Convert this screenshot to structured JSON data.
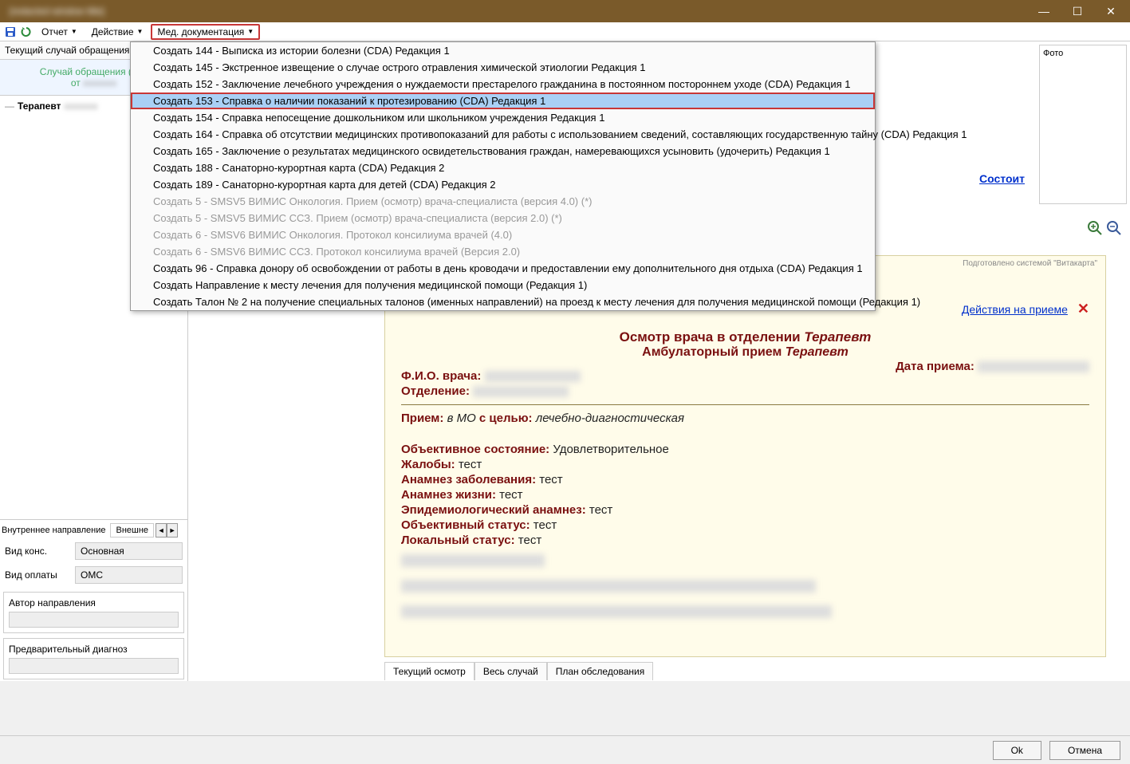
{
  "titlebar": {
    "text": "[redacted window title]"
  },
  "toolbar": {
    "report": "Отчет",
    "action": "Действие",
    "med_doc": "Мед. документация"
  },
  "left": {
    "current_case": "Текущий случай обращения",
    "case_line1": "Случай обращения (<не",
    "case_line2": "от",
    "tree_specialist": "Терапевт",
    "tab_internal": "Внутреннее направление",
    "tab_external": "Внешне",
    "cons_label": "Вид конс.",
    "cons_value": "Основная",
    "pay_label": "Вид оплаты",
    "pay_value": "ОМС",
    "author_label": "Автор направления",
    "diag_label": "Предварительный диагноз"
  },
  "right": {
    "photo": "Фото",
    "status": "Состоит",
    "watermark": "Подготовлено системой \"Витакарта\"",
    "actions_link": "Действия на приеме",
    "doc_title_1": "Осмотр врача в отделении ",
    "doc_title_1_ital": "Терапевт",
    "doc_title_2": "Амбулаторный прием ",
    "doc_title_2_ital": "Терапевт",
    "doctor_label": "Ф.И.О. врача:",
    "dept_label": "Отделение:",
    "date_label": "Дата приема:",
    "visit_label": "Прием:",
    "visit_where": "в МО",
    "visit_goal_label": "с целью:",
    "visit_goal": "лечебно-диагностическая",
    "obj_state_label": "Объективное состояние:",
    "obj_state_val": "Удовлетворительное",
    "complaints_label": "Жалобы:",
    "test": "тест",
    "anamnez_dis_label": "Анамнез заболевания:",
    "anamnez_life_label": "Анамнез жизни:",
    "epid_label": "Эпидемиологический анамнез:",
    "obj_status_label": "Объективный статус:",
    "local_status_label": "Локальный статус:"
  },
  "bottom_tabs": {
    "current": "Текущий осмотр",
    "full": "Весь случай",
    "plan": "План обследования"
  },
  "footer": {
    "ok": "Ok",
    "cancel": "Отмена"
  },
  "dropdown": [
    {
      "text": "Создать 144 -  Выписка из истории болезни (CDA) Редакция 1",
      "disabled": false,
      "selected": false
    },
    {
      "text": "Создать 145 - Экстренное извещение о случае острого отравления химической этиологии Редакция 1",
      "disabled": false,
      "selected": false
    },
    {
      "text": "Создать 152 - Заключение лечебного учреждения о нуждаемости престарелого гражданина в постоянном постороннем уходе (CDA) Редакция 1",
      "disabled": false,
      "selected": false
    },
    {
      "text": "Создать 153 - Справка о наличии показаний к протезированию (CDA) Редакция 1",
      "disabled": false,
      "selected": true
    },
    {
      "text": "Создать 154 - Справка непосещение дошкольником или школьником учреждения Редакция 1",
      "disabled": false,
      "selected": false
    },
    {
      "text": "Создать 164 - Справка об отсутствии медицинских противопоказаний для работы с использованием сведений, составляющих государственную тайну (CDA) Редакция 1",
      "disabled": false,
      "selected": false
    },
    {
      "text": "Создать 165 - Заключение о результатах медицинского освидетельствования граждан, намеревающихся усыновить (удочерить) Редакция 1",
      "disabled": false,
      "selected": false
    },
    {
      "text": "Создать 188 - Санаторно-курортная карта (CDA) Редакция 2",
      "disabled": false,
      "selected": false
    },
    {
      "text": "Создать 189 - Санаторно-курортная карта для детей (CDA) Редакция 2",
      "disabled": false,
      "selected": false
    },
    {
      "text": "Создать 5 - SMSV5 ВИМИС Онкология. Прием (осмотр) врача-специалиста  (версия 4.0) (*)",
      "disabled": true,
      "selected": false
    },
    {
      "text": "Создать 5 - SMSV5 ВИМИС ССЗ. Прием (осмотр) врача-специалиста (версия 2.0) (*)",
      "disabled": true,
      "selected": false
    },
    {
      "text": "Создать 6 - SMSV6 ВИМИС Онкология. Протокол консилиума врачей (4.0)",
      "disabled": true,
      "selected": false
    },
    {
      "text": "Создать 6 - SMSV6 ВИМИС ССЗ. Протокол консилиума врачей (Версия 2.0)",
      "disabled": true,
      "selected": false
    },
    {
      "text": "Создать 96 - Справка донору об освобождении от работы в день кроводачи и предоставлении ему дополнительного дня отдыха (CDA) Редакция 1",
      "disabled": false,
      "selected": false
    },
    {
      "text": "Создать Направление к месту лечения для получения медицинской помощи (Редакция 1)",
      "disabled": false,
      "selected": false
    },
    {
      "text": "Создать Талон № 2 на получение специальных талонов (именных направлений) на проезд к месту лечения для получения медицинской помощи (Редакция 1)",
      "disabled": false,
      "selected": false
    }
  ]
}
